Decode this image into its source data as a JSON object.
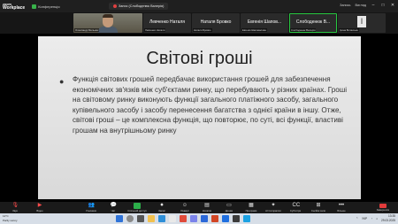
{
  "titlebar": {
    "brand_top": "zoom",
    "brand_bottom": "Workplace",
    "conference_label": "Конференція",
    "recording_label": "Запис (Слободенюк Валерія)",
    "right_label": "Запись",
    "view_label": "Вигляд"
  },
  "participants": [
    {
      "display_name": "",
      "label": "Олександр Мельник",
      "type": "camera"
    },
    {
      "display_name": "Левченко Наталя",
      "label": "Левченко Наталя",
      "type": "name"
    },
    {
      "display_name": "Наталя Бровко",
      "label": "Наталя Бровко",
      "type": "name"
    },
    {
      "display_name": "Евгенія Шапов...",
      "label": "Евгенія Шаповалова",
      "type": "name"
    },
    {
      "display_name": "Слободенюк В...",
      "label": "Слободенюк Валерія",
      "type": "name",
      "active": true
    },
    {
      "display_name": "",
      "label": "Ірина Білинська",
      "type": "letter",
      "letter": "I"
    }
  ],
  "slide": {
    "title": "Світові гроші",
    "bullet": "●",
    "body": "Функція світових грошей передбачає використання грошей для забезпечення економічних зв'язків між суб'єктами ринку, що перебувають у різних країнах. Гроші на світовому ринку виконують функції загального платіжного засобу, загального купівельного засобу і засобу перенесення багатства з однієї країни в іншу. Отже, світові гроші – це комплексна функція, що повторює, по суті, всі функції, властиві грошам на внутрішньому ринку"
  },
  "toolbar": {
    "audio": "Звук",
    "video": "Відео",
    "participants": "Учасники",
    "chat": "Чат",
    "share": "Спільний доступ",
    "record": "Запис",
    "reactions": "Реакції",
    "notes": "Нотатки",
    "whiteboard": "Дошки",
    "apps": "Програми",
    "ai": "AI Companion",
    "captions": "Субтитри",
    "rooms": "Сесійні зали",
    "more": "Більше",
    "end": "Завершити"
  },
  "taskbar": {
    "weather_temp": "12°C",
    "weather_desc": "Partly sunny",
    "language": "УКР",
    "time": "13:35",
    "date": "29.03.2025"
  },
  "colors": {
    "active_speaker": "#28c840",
    "record_red": "#e04040",
    "share_green": "#2cae4a",
    "end_red": "#e23b3b"
  }
}
